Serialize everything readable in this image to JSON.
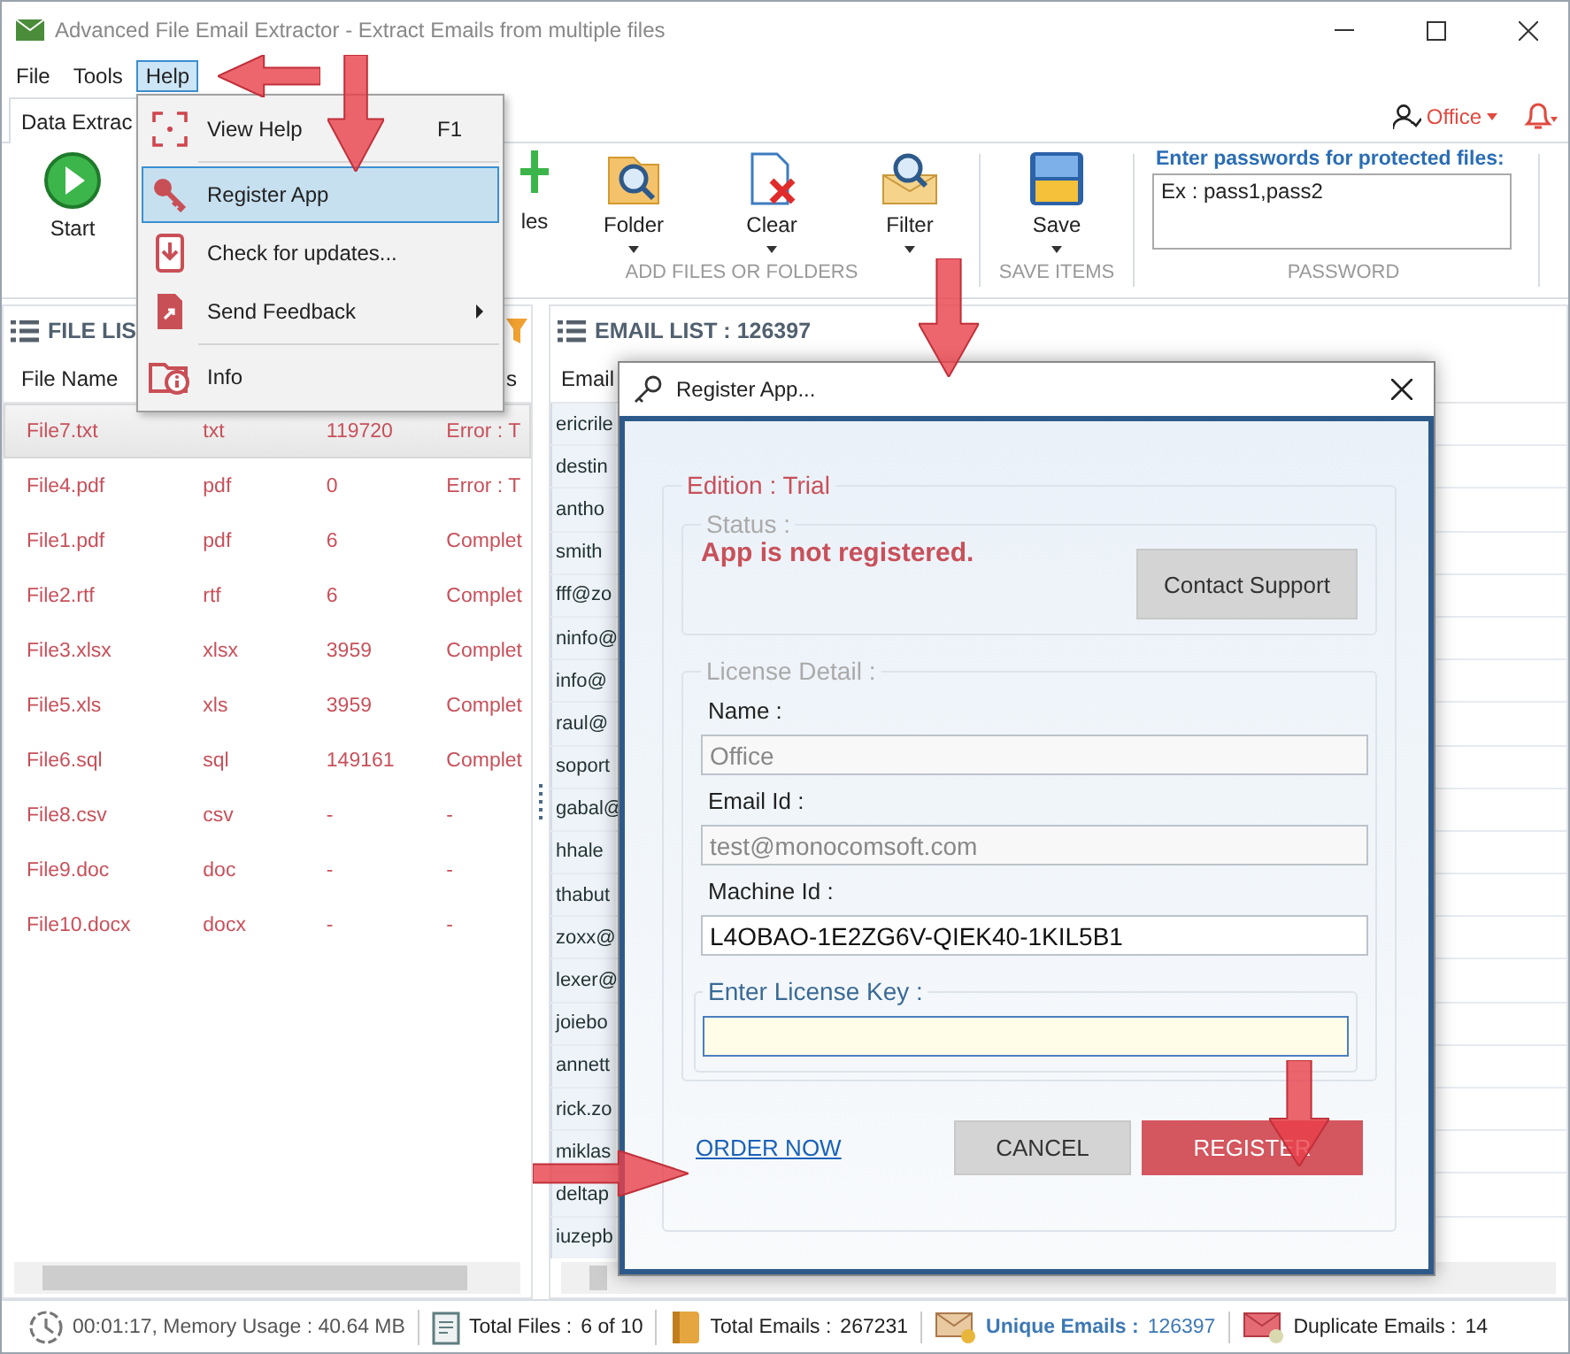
{
  "window": {
    "title": "Advanced File Email Extractor - Extract Emails from multiple files"
  },
  "menu_bar": [
    {
      "label": "File",
      "selected": false
    },
    {
      "label": "Tools",
      "selected": false
    },
    {
      "label": "Help",
      "selected": true
    }
  ],
  "ribbon": {
    "tab": "Data Extrac",
    "user": "Office",
    "start": {
      "label": "Start"
    },
    "add_buttons": [
      {
        "label": "les",
        "kind": "files",
        "dropdown": false
      },
      {
        "label": "Folder",
        "kind": "folder",
        "dropdown": true
      },
      {
        "label": "Clear",
        "kind": "clear",
        "dropdown": true
      },
      {
        "label": "Filter",
        "kind": "filter",
        "dropdown": true
      }
    ],
    "add_group": "ADD FILES OR FOLDERS",
    "save": {
      "label": "Save",
      "group": "SAVE ITEMS",
      "dropdown": true
    },
    "password": {
      "label": "Enter passwords for protected files:",
      "value": "Ex : pass1,pass2",
      "group": "PASSWORD"
    }
  },
  "help_menu": [
    {
      "label": "View Help",
      "shortcut": "F1",
      "kind": "help",
      "selected": false,
      "submenu": false
    },
    {
      "label": "Register App",
      "kind": "key",
      "selected": true,
      "submenu": false
    },
    {
      "label": "Check for updates...",
      "kind": "update",
      "selected": false,
      "submenu": false
    },
    {
      "label": "Send Feedback",
      "kind": "feedback",
      "selected": false,
      "submenu": true
    },
    {
      "label": "Info",
      "kind": "info",
      "selected": false,
      "submenu": false
    }
  ],
  "file_list": {
    "title": "FILE LIS",
    "columns": [
      "File Name",
      "s"
    ],
    "rows": [
      {
        "name": "File7.txt",
        "type": "txt",
        "count": "119720",
        "status": "Error : T",
        "selected": true
      },
      {
        "name": "File4.pdf",
        "type": "pdf",
        "count": "0",
        "status": "Error : T",
        "selected": false
      },
      {
        "name": "File1.pdf",
        "type": "pdf",
        "count": "6",
        "status": "Complet",
        "selected": false
      },
      {
        "name": "File2.rtf",
        "type": "rtf",
        "count": "6",
        "status": "Complet",
        "selected": false
      },
      {
        "name": "File3.xlsx",
        "type": "xlsx",
        "count": "3959",
        "status": "Complet",
        "selected": false
      },
      {
        "name": "File5.xls",
        "type": "xls",
        "count": "3959",
        "status": "Complet",
        "selected": false
      },
      {
        "name": "File6.sql",
        "type": "sql",
        "count": "149161",
        "status": "Complet",
        "selected": false
      },
      {
        "name": "File8.csv",
        "type": "csv",
        "count": "-",
        "status": "-",
        "selected": false
      },
      {
        "name": "File9.doc",
        "type": "doc",
        "count": "-",
        "status": "-",
        "selected": false
      },
      {
        "name": "File10.docx",
        "type": "docx",
        "count": "-",
        "status": "-",
        "selected": false
      }
    ]
  },
  "email_list": {
    "title": "EMAIL LIST : 126397",
    "columns": [
      "Email"
    ],
    "rows": [
      "ericrile",
      "destin",
      "antho",
      "smith",
      "fff@zo",
      "ninfo@",
      "info@",
      "raul@",
      "soport",
      "gabal@",
      "hhale",
      "thabut",
      "zoxx@",
      "lexer@",
      "joiebo",
      "annett",
      "rick.zo",
      "miklas",
      "deltap",
      "iuzepb"
    ]
  },
  "dialog": {
    "title": "Register App...",
    "edition": "Edition : Trial",
    "status_label": "Status :",
    "status_text": "App is not registered.",
    "contact_button": "Contact Support",
    "license_label": "License Detail :",
    "fields": [
      {
        "label": "Name :",
        "value": "Office",
        "disabled": true
      },
      {
        "label": "Email Id :",
        "value": "test@monocomsoft.com",
        "disabled": true
      },
      {
        "label": "Machine Id :",
        "value": "L4OBAO-1E2ZG6V-QIEK40-1KIL5B1",
        "disabled": false
      }
    ],
    "license_key": {
      "label": "Enter License Key :"
    },
    "order_link": "ORDER NOW",
    "buttons": [
      {
        "label": "CANCEL",
        "kind": "cancel"
      },
      {
        "label": "REGISTER",
        "kind": "register"
      }
    ]
  },
  "status_bar": {
    "time_memory": "00:01:17, Memory Usage : 40.64 MB",
    "items": [
      {
        "label": "Total Files :",
        "value": "6 of 10",
        "kind": "files"
      },
      {
        "label": "Total Emails :",
        "value": "267231",
        "kind": "total"
      },
      {
        "label": "Unique Emails :",
        "value": "126397",
        "kind": "unique"
      },
      {
        "label": "Duplicate Emails :",
        "value": "14",
        "kind": "duplicate"
      }
    ]
  }
}
